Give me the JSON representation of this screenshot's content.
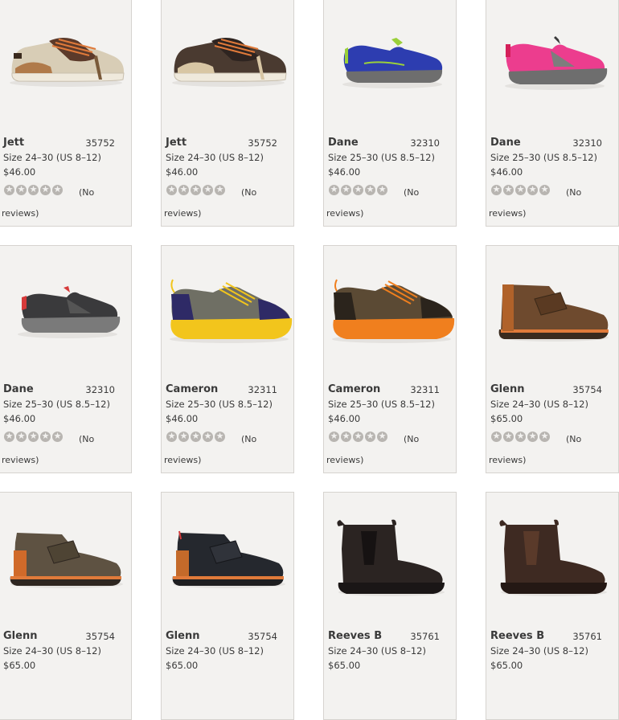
{
  "products": [
    {
      "name": "Jett",
      "sku": "35752",
      "size": "Size 24–30 (US 8–12)",
      "price": "$46.00",
      "shoe": "sneaker-tan-icon"
    },
    {
      "name": "Jett",
      "sku": "35752",
      "size": "Size 24–30 (US 8–12)",
      "price": "$46.00",
      "shoe": "sneaker-brown-icon"
    },
    {
      "name": "Dane",
      "sku": "32310",
      "size": "Size 25–30 (US 8.5–12)",
      "price": "$46.00",
      "shoe": "slipon-blue-icon"
    },
    {
      "name": "Dane",
      "sku": "32310",
      "size": "Size 25–30 (US 8.5–12)",
      "price": "$46.00",
      "shoe": "slipon-pink-icon"
    },
    {
      "name": "Dane",
      "sku": "32310",
      "size": "Size 25–30 (US 8.5–12)",
      "price": "$46.00",
      "shoe": "slipon-black-icon"
    },
    {
      "name": "Cameron",
      "sku": "32311",
      "size": "Size 25–30 (US 8.5–12)",
      "price": "$46.00",
      "shoe": "hiker-grey-icon"
    },
    {
      "name": "Cameron",
      "sku": "32311",
      "size": "Size 25–30 (US 8.5–12)",
      "price": "$46.00",
      "shoe": "hiker-brown-icon"
    },
    {
      "name": "Glenn",
      "sku": "35754",
      "size": "Size 24–30 (US 8–12)",
      "price": "$65.00",
      "shoe": "boot-velcro-brown-icon"
    },
    {
      "name": "Glenn",
      "sku": "35754",
      "size": "Size 24–30 (US 8–12)",
      "price": "$65.00",
      "shoe": "boot-velcro-olive-icon"
    },
    {
      "name": "Glenn",
      "sku": "35754",
      "size": "Size 24–30 (US 8–12)",
      "price": "$65.00",
      "shoe": "boot-velcro-black-icon"
    },
    {
      "name": "Reeves B",
      "sku": "35761",
      "size": "Size 24–30 (US 8–12)",
      "price": "$65.00",
      "shoe": "chelsea-black-icon"
    },
    {
      "name": "Reeves B",
      "sku": "35761",
      "size": "Size 24–30 (US 8–12)",
      "price": "$65.00",
      "shoe": "chelsea-brown-icon"
    }
  ],
  "reviews": {
    "line1": "(No",
    "line2": "reviews)"
  },
  "rating": {
    "stars": 0,
    "max": 5
  },
  "colors": {
    "card": "#f3f2f0",
    "border": "#d6d3cf",
    "star": "#b8b5b1",
    "text": "#3a3a3a"
  }
}
